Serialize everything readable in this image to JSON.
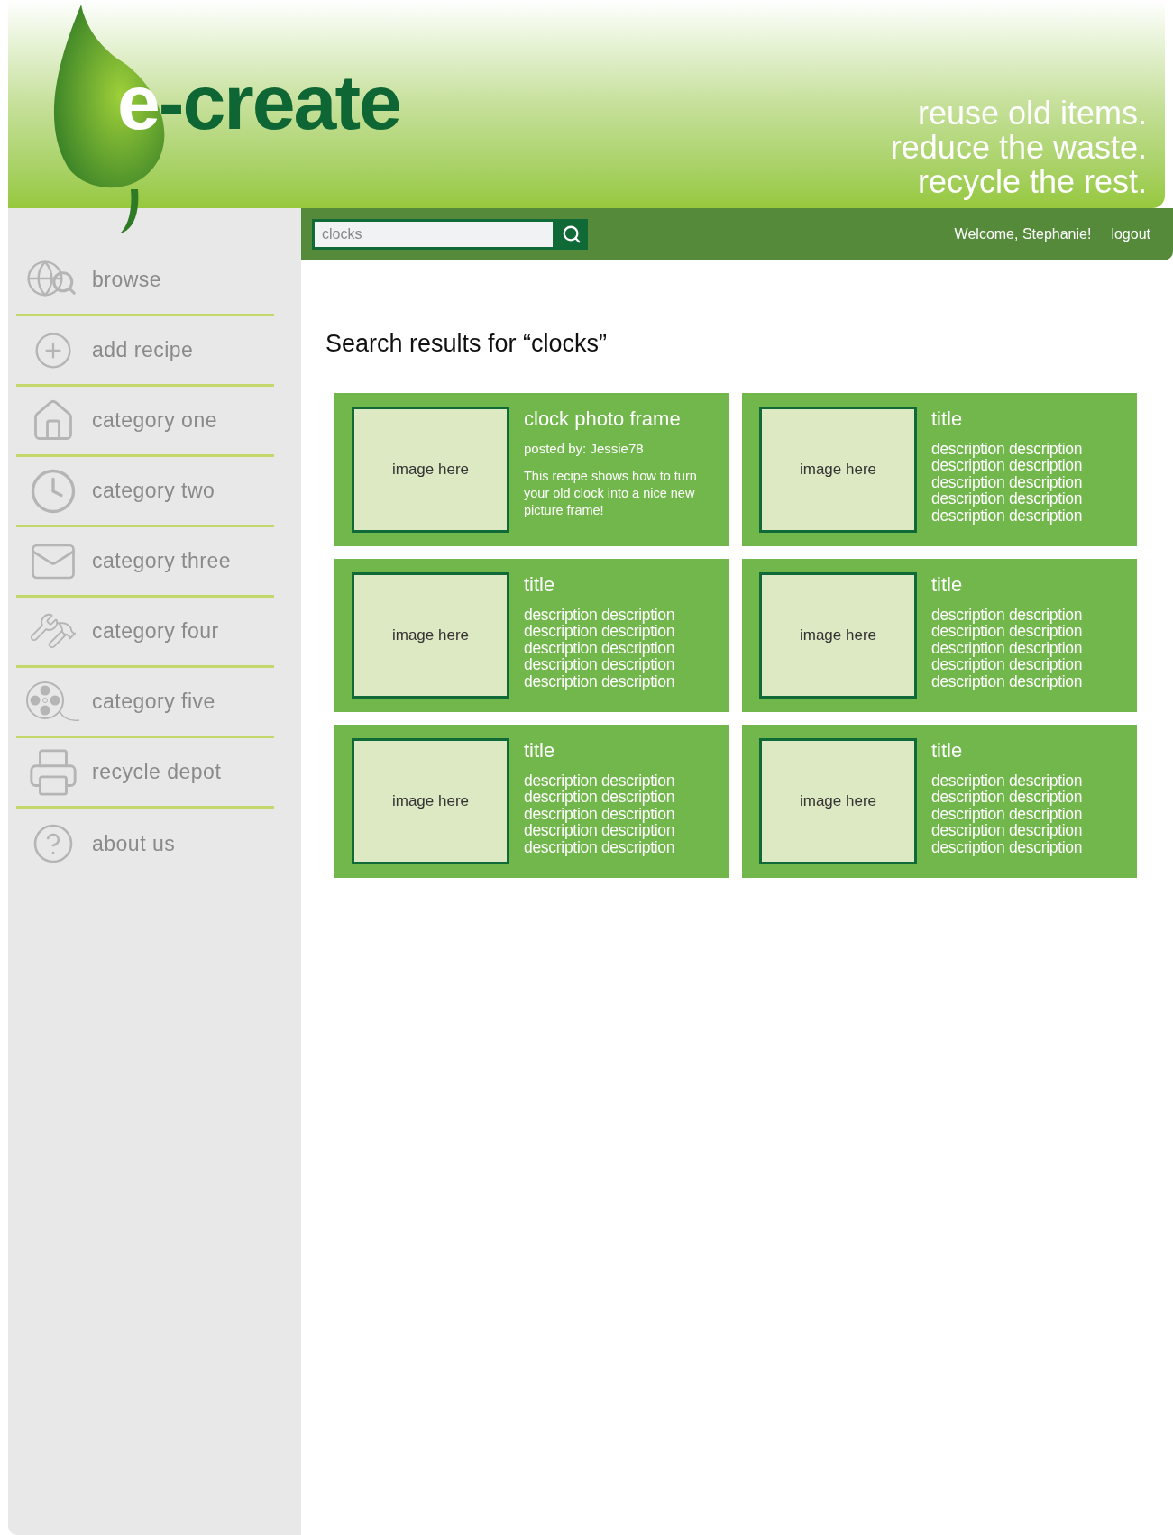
{
  "header": {
    "logo": {
      "lead": "e",
      "rest": "-create"
    },
    "tagline": [
      "reuse old items.",
      "reduce the waste.",
      "recycle the rest."
    ]
  },
  "toolbar": {
    "search": {
      "value": "clocks"
    },
    "welcome": "Welcome, Stephanie!",
    "logout": "logout"
  },
  "sidebar": {
    "items": [
      {
        "label": "browse",
        "kind": "globe"
      },
      {
        "label": "add recipe",
        "kind": "plus"
      },
      {
        "label": "category one",
        "kind": "house"
      },
      {
        "label": "category two",
        "kind": "clock"
      },
      {
        "label": "category three",
        "kind": "envelope"
      },
      {
        "label": "category four",
        "kind": "tools"
      },
      {
        "label": "category five",
        "kind": "reel"
      },
      {
        "label": "recycle depot",
        "kind": "printer"
      },
      {
        "label": "about us",
        "kind": "question"
      }
    ]
  },
  "heading": "Search results for “clocks”",
  "results": [
    {
      "kind": "recipe",
      "image_label": "image here",
      "title": "clock photo frame",
      "posted_by": "posted by: Jessie78",
      "body": "This recipe shows how to turn your old clock into a nice new picture frame!"
    },
    {
      "kind": "placeholder",
      "image_label": "image here",
      "title": "title",
      "body": "description description description description description description description description description description"
    },
    {
      "kind": "placeholder",
      "image_label": "image here",
      "title": "title",
      "body": "description description description description description description description description description description"
    },
    {
      "kind": "placeholder",
      "image_label": "image here",
      "title": "title",
      "body": "description description description description description description description description description description"
    },
    {
      "kind": "placeholder",
      "image_label": "image here",
      "title": "title",
      "body": "description description description description description description description description description description"
    },
    {
      "kind": "placeholder",
      "image_label": "image here",
      "title": "title",
      "body": "description description description description description description description description description description"
    }
  ]
}
